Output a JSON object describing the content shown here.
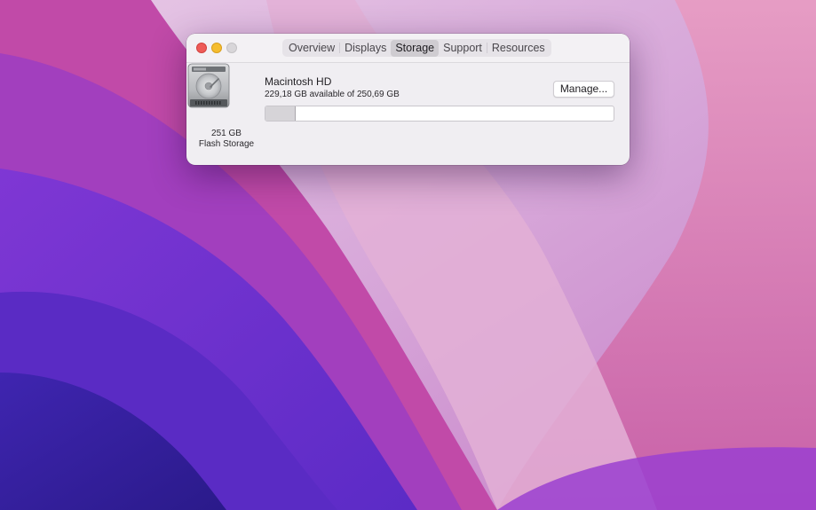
{
  "window": {
    "tabs": [
      {
        "label": "Overview",
        "active": false
      },
      {
        "label": "Displays",
        "active": false
      },
      {
        "label": "Storage",
        "active": true
      },
      {
        "label": "Support",
        "active": false
      },
      {
        "label": "Resources",
        "active": false
      }
    ]
  },
  "storage": {
    "disk_size": "251 GB",
    "disk_type": "Flash Storage",
    "volume_name": "Macintosh HD",
    "availability": "229,18 GB available of 250,69 GB",
    "manage_label": "Manage...",
    "used_fraction": 0.0858
  },
  "colors": {
    "close": "#ee5b57",
    "minimize": "#f5bd2f",
    "zoom_disabled": "#d8d6d9"
  }
}
